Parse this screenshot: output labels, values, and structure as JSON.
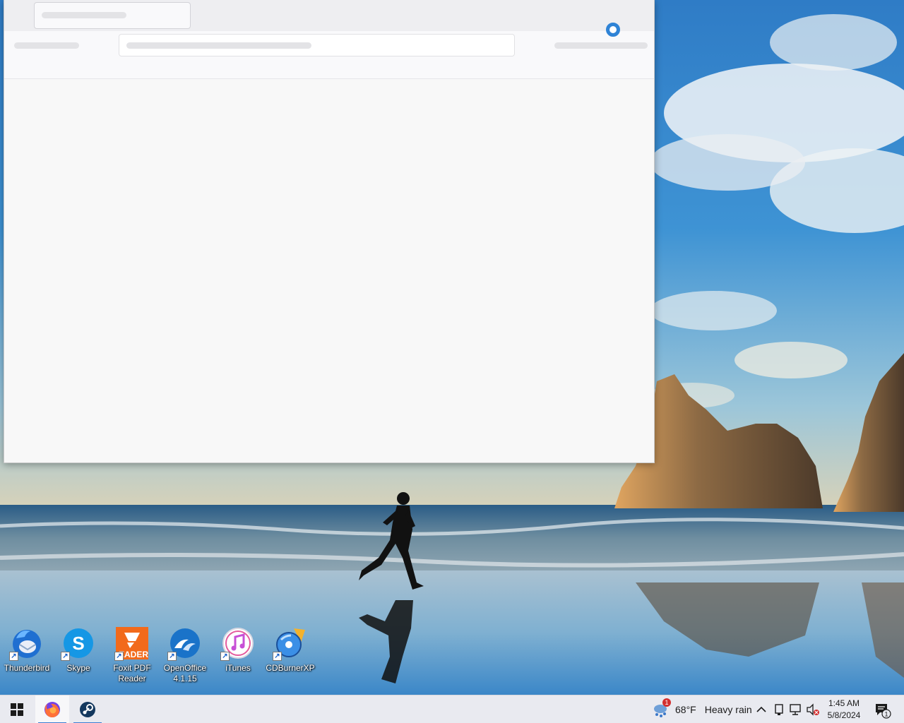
{
  "desktop": {
    "icons": [
      {
        "id": "thunderbird",
        "label": "Thunderbird",
        "icon": "thunderbird-icon"
      },
      {
        "id": "skype",
        "label": "Skype",
        "icon": "skype-icon"
      },
      {
        "id": "foxit",
        "label": "Foxit PDF Reader",
        "icon": "foxit-reader-icon"
      },
      {
        "id": "openoffice",
        "label": "OpenOffice 4.1.15",
        "icon": "openoffice-icon"
      },
      {
        "id": "itunes",
        "label": "iTunes",
        "icon": "itunes-icon"
      },
      {
        "id": "cdburnerxp",
        "label": "CDBurnerXP",
        "icon": "cdburnerxp-icon"
      }
    ],
    "foxit_badge_text": "EADER",
    "skype_letter": "S"
  },
  "taskbar": {
    "pinned": [
      {
        "id": "firefox",
        "icon": "firefox-icon",
        "active": true
      },
      {
        "id": "steam",
        "icon": "steam-icon",
        "active": false
      }
    ],
    "weather": {
      "temp": "68°F",
      "condition": "Heavy rain",
      "alert_count": "1"
    },
    "clock": {
      "time": "1:45 AM",
      "date": "5/8/2024"
    },
    "notification_count": "1"
  },
  "colors": {
    "accent": "#2f83d6",
    "taskbar": "#e9eaf0"
  }
}
